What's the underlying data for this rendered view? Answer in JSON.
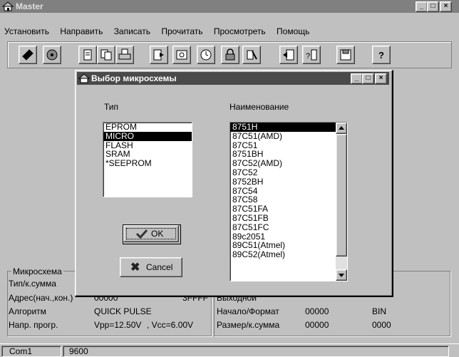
{
  "app": {
    "title": "Master"
  },
  "menu": [
    "Установить",
    "Направить",
    "Записать",
    "Прочитать",
    "Просмотреть",
    "Помощь"
  ],
  "toolbar": [
    {
      "icon": "chip-icon"
    },
    {
      "icon": "disc-icon"
    },
    {
      "icon": "page-icon"
    },
    {
      "icon": "copy-icon"
    },
    {
      "icon": "print-icon"
    },
    {
      "icon": "program-icon"
    },
    {
      "icon": "verify-icon"
    },
    {
      "icon": "clock-icon"
    },
    {
      "icon": "lock-icon"
    },
    {
      "icon": "erase-icon"
    },
    {
      "icon": "transfer-icon"
    },
    {
      "icon": "compare-icon"
    },
    {
      "icon": "save-icon"
    },
    {
      "icon": "help-icon"
    }
  ],
  "dialog": {
    "title": "Выбор микросхемы",
    "type_label": "Тип",
    "name_label": "Наименование",
    "types": [
      "EPROM",
      "MICRO",
      "FLASH",
      "SRAM",
      "*SEEPROM"
    ],
    "selected_type": "MICRO",
    "names": [
      "8751H",
      "87C51(AMD)",
      "87C51",
      "8751BH",
      "87C52(AMD)",
      "87C52",
      "8752BH",
      "87C54",
      "87C58",
      "87C51FA",
      "87C51FB",
      "87C51FC",
      "89c2051",
      "89C51(Atmel)",
      "89C52(Atmel)"
    ],
    "selected_name": "8751H",
    "ok_label": "OK",
    "cancel_label": "Cancel"
  },
  "chip_panel": {
    "group_label": "Микросхема",
    "rows": [
      {
        "label": "Тип/к.сумма",
        "value": "",
        "value2": ""
      },
      {
        "label": "Адрес(нач.,кон.)",
        "value": "00000",
        "value2": "3FFFF"
      },
      {
        "label": "Алгоритм",
        "value": "QUICK PULSE",
        "value2": ""
      },
      {
        "label": "Напр. прогр.",
        "value": "Vpp=12.50V",
        "value2": ", Vcc=6.00V"
      }
    ]
  },
  "file_panel": {
    "rows": [
      {
        "label": "Выходной",
        "value": "",
        "value2": ""
      },
      {
        "label": "Начало/Формат",
        "value": "00000",
        "value2": "BIN"
      },
      {
        "label": "Размер/к.сумма",
        "value": "00000",
        "value2": "0000"
      }
    ]
  },
  "status": {
    "port": "Com1",
    "baud": "9600"
  }
}
